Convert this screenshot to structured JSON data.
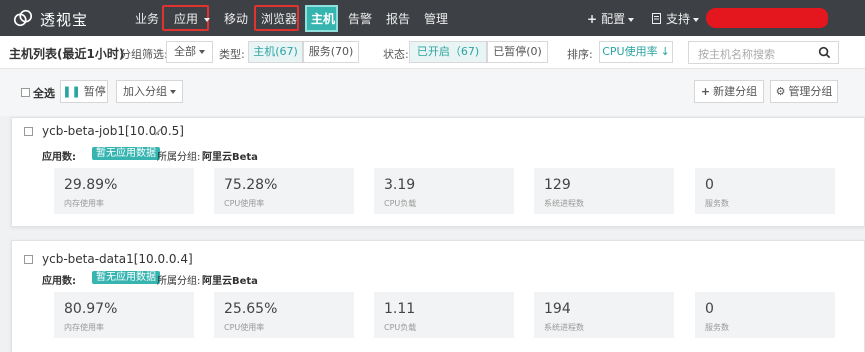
{
  "brand": {
    "name": "透视宝"
  },
  "nav": {
    "items": [
      {
        "key": "business",
        "label": "业务"
      },
      {
        "key": "apps",
        "label": "应用"
      },
      {
        "key": "mobile",
        "label": "移动"
      },
      {
        "key": "browser",
        "label": "浏览器"
      },
      {
        "key": "hosts",
        "label": "主机"
      },
      {
        "key": "alerts",
        "label": "告警"
      },
      {
        "key": "reports",
        "label": "报告"
      },
      {
        "key": "admin",
        "label": "管理"
      }
    ],
    "config": "配置",
    "support": "支持"
  },
  "filterbar": {
    "title": "主机列表(最近1小时)",
    "group_filter_label": "分组筛选:",
    "group_filter_value": "全部",
    "type_label": "类型:",
    "type_hosts": "主机(67)",
    "type_services": "服务(70)",
    "status_label": "状态:",
    "status_enabled": "已开启（67)",
    "status_paused": "已暂停(0)",
    "sort_label": "排序:",
    "sort_value": "CPU使用率",
    "search_placeholder": "按主机名称搜索"
  },
  "toolbar": {
    "select_all": "全选",
    "pause": "暂停",
    "add_group": "加入分组",
    "new_group": "新建分组",
    "manage_group": "管理分组"
  },
  "hosts": [
    {
      "name": "ycb-beta-job1[10.0.0.5]",
      "apps_label": "应用数:",
      "apps_badge": "暂无应用数据",
      "group_label": "所属分组:",
      "group_value": "阿里云Beta",
      "stats": [
        {
          "value": "29.89%",
          "label": "内存使用率"
        },
        {
          "value": "75.28%",
          "label": "CPU使用率"
        },
        {
          "value": "3.19",
          "label": "CPU负载"
        },
        {
          "value": "129",
          "label": "系统进程数"
        },
        {
          "value": "0",
          "label": "服务数"
        }
      ]
    },
    {
      "name": "ycb-beta-data1[10.0.0.4]",
      "apps_label": "应用数:",
      "apps_badge": "暂无应用数据",
      "group_label": "所属分组:",
      "group_value": "阿里云Beta",
      "stats": [
        {
          "value": "80.97%",
          "label": "内存使用率"
        },
        {
          "value": "25.65%",
          "label": "CPU使用率"
        },
        {
          "value": "1.11",
          "label": "CPU负载"
        },
        {
          "value": "194",
          "label": "系统进程数"
        },
        {
          "value": "0",
          "label": "服务数"
        }
      ]
    }
  ]
}
